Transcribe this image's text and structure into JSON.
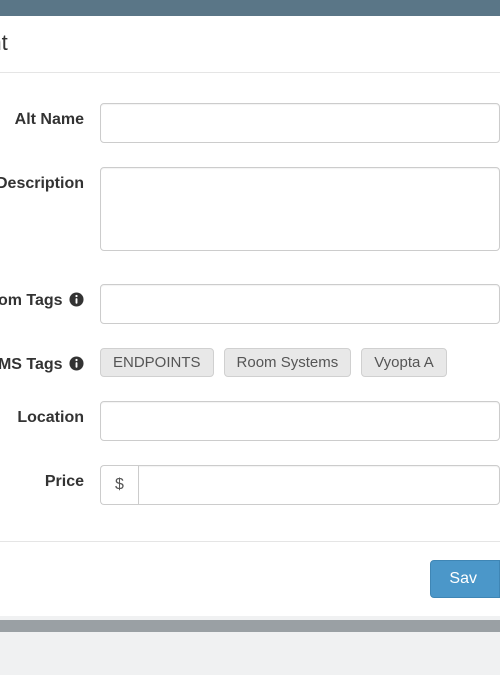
{
  "modal": {
    "title": "point"
  },
  "fields": {
    "altName": {
      "label": "Alt Name",
      "value": ""
    },
    "description": {
      "label": "Description",
      "value": ""
    },
    "customTags": {
      "label": "om Tags",
      "value": ""
    },
    "tmsTags": {
      "label": "MS Tags",
      "tags": [
        "ENDPOINTS",
        "Room Systems",
        "Vyopta A"
      ]
    },
    "location": {
      "label": "Location",
      "value": ""
    },
    "price": {
      "label": "Price",
      "currency": "$",
      "value": ""
    }
  },
  "footer": {
    "save_label": "Sav"
  }
}
